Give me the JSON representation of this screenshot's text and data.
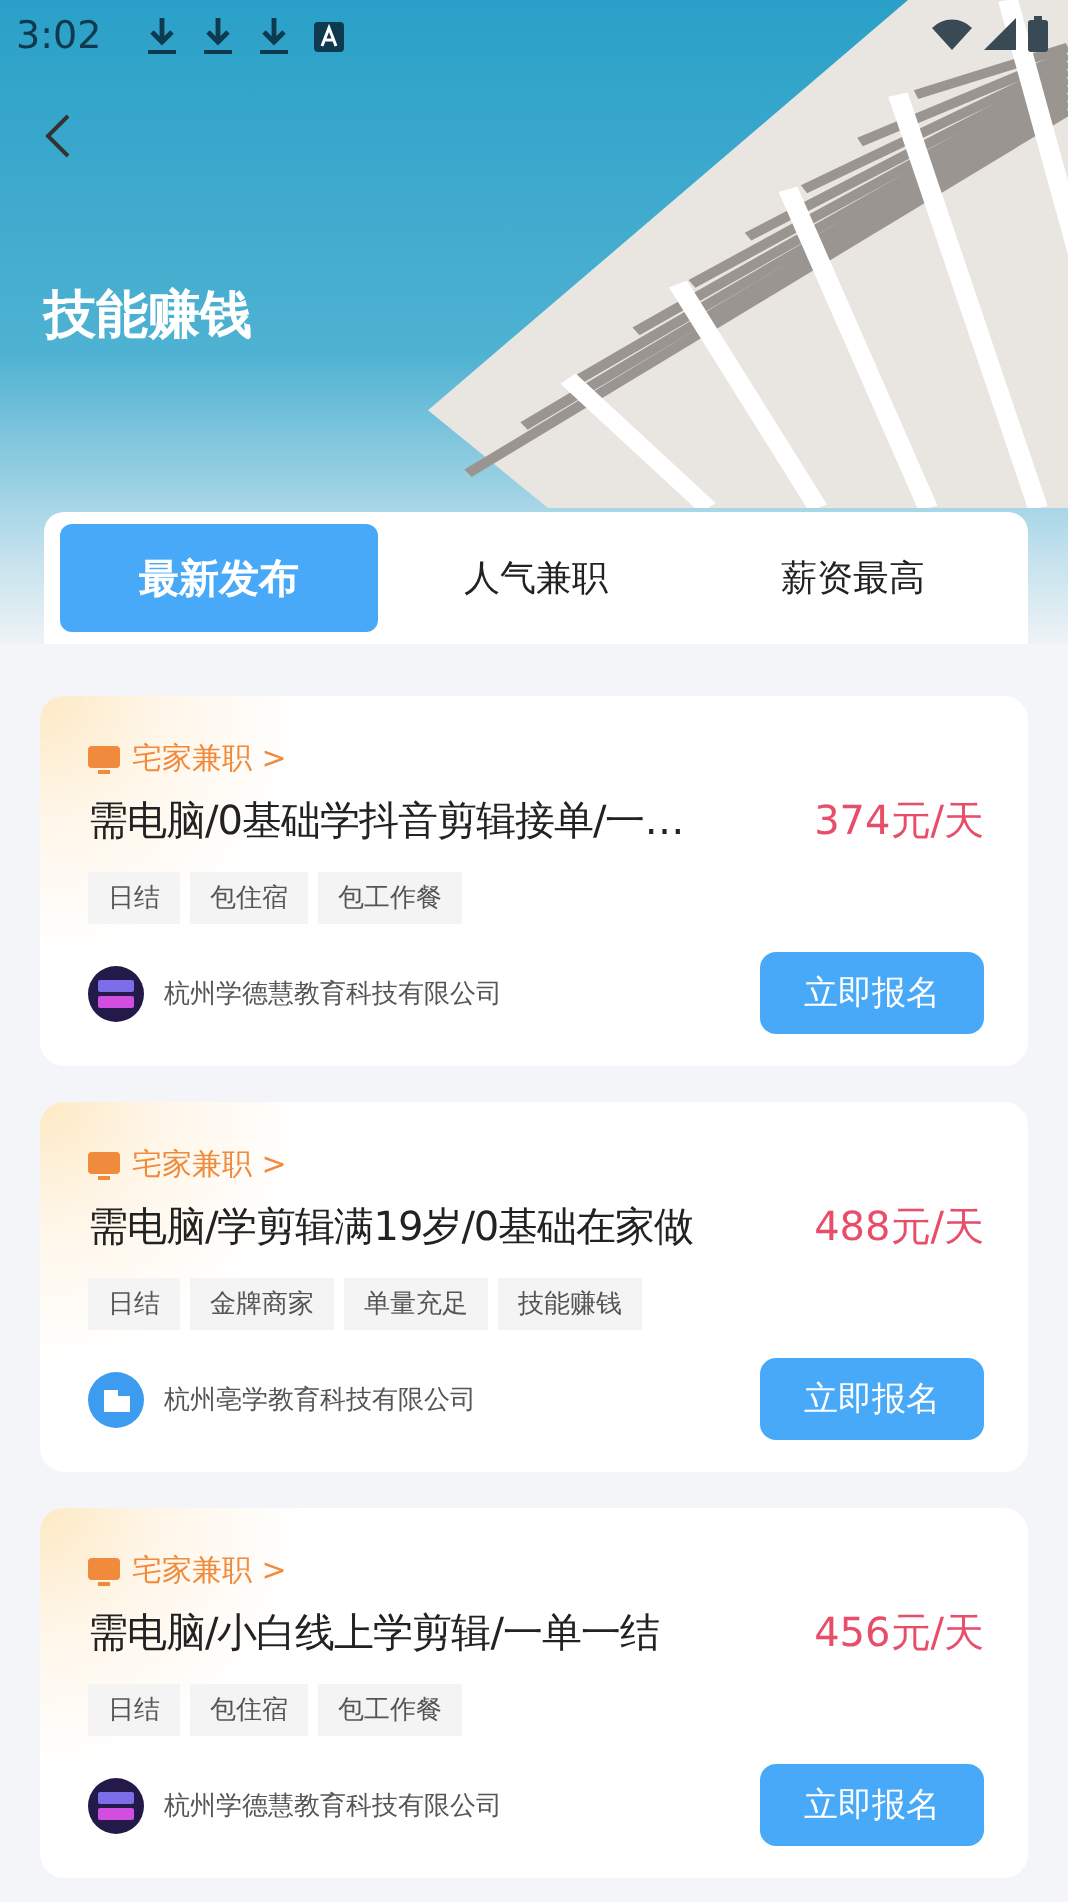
{
  "status_bar": {
    "time": "3:02"
  },
  "page": {
    "title": "技能赚钱"
  },
  "tabs": [
    {
      "label": "最新发布",
      "selected": true
    },
    {
      "label": "人气兼职",
      "selected": false
    },
    {
      "label": "薪资最高",
      "selected": false
    }
  ],
  "jobs": [
    {
      "category": "宅家兼职 >",
      "title": "需电脑/0基础学抖音剪辑接单/一…",
      "salary": "374元/天",
      "tags": [
        "日结",
        "包住宿",
        "包工作餐"
      ],
      "company": "杭州学德慧教育科技有限公司",
      "logo": {
        "kind": "video"
      },
      "button": "立即报名"
    },
    {
      "category": "宅家兼职 >",
      "title": "需电脑/学剪辑满19岁/0基础在家做",
      "salary": "488元/天",
      "tags": [
        "日结",
        "金牌商家",
        "单量充足",
        "技能赚钱"
      ],
      "company": "杭州亳学教育科技有限公司",
      "logo": {
        "kind": "building"
      },
      "button": "立即报名"
    },
    {
      "category": "宅家兼职 >",
      "title": "需电脑/小白线上学剪辑/一单一结",
      "salary": "456元/天",
      "tags": [
        "日结",
        "包住宿",
        "包工作餐"
      ],
      "company": "杭州学德慧教育科技有限公司",
      "logo": {
        "kind": "video"
      },
      "button": "立即报名"
    }
  ]
}
